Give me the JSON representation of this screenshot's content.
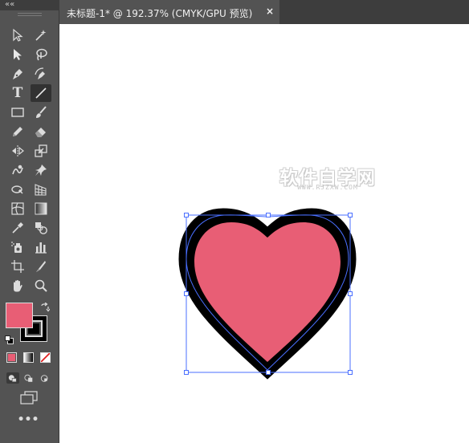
{
  "document_tab": {
    "title": "未标题-1* @ 192.37% (CMYK/GPU 预览)",
    "close_glyph": "×"
  },
  "toolbar": {
    "collapse_glyph": "««",
    "more_tools_glyph": "•••",
    "active_tool": "line-segment-tool",
    "tools": [
      "selection-tool",
      "magic-wand-tool",
      "direct-selection-tool",
      "lasso-tool",
      "pen-tool",
      "curvature-tool",
      "type-tool",
      "line-segment-tool",
      "rectangle-tool",
      "paintbrush-tool",
      "shaper-tool",
      "eraser-tool",
      "reflect-tool",
      "scale-tool",
      "warp-tool",
      "puppet-warp-tool",
      "free-transform-tool",
      "perspective-grid-tool",
      "mesh-tool",
      "gradient-tool",
      "eyedropper-tool",
      "blend-tool",
      "symbol-sprayer-tool",
      "column-graph-tool",
      "artboard-tool",
      "slice-tool",
      "hand-tool",
      "zoom-tool"
    ],
    "type_tool_letter": "T",
    "fill_color": "#e85e75",
    "stroke_color": "#000000"
  },
  "canvas": {
    "background": "#ffffff",
    "watermark_text": "软件自学网",
    "watermark_url": "WWW.RJZXW.COM",
    "heart_fill_color": "#e85e75",
    "heart_stroke_color": "#000000",
    "selection_color": "#4a6fff"
  }
}
